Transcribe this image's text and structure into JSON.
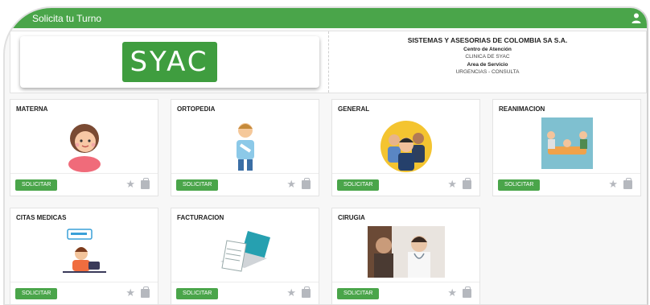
{
  "appbar": {
    "title": "Solicita tu Turno"
  },
  "header": {
    "logo_text": "SYAC",
    "company": "SISTEMAS Y ASESORIAS DE COLOMBIA SA S.A.",
    "centro_label": "Centro de Atención",
    "centro_value": "CLINICA DE SYAC",
    "area_label": "Area de Servicio",
    "area_value": "URGENCIAS - CONSULTA"
  },
  "cards": [
    {
      "title": "MATERNA",
      "button": "SOLICITAR"
    },
    {
      "title": "ORTOPEDIA",
      "button": "SOLICITAR"
    },
    {
      "title": "GENERAL",
      "button": "SOLICITAR"
    },
    {
      "title": "REANIMACION",
      "button": "SOLICITAR"
    },
    {
      "title": "CITAS MEDICAS",
      "button": "SOLICITAR"
    },
    {
      "title": "FACTURACION",
      "button": "SOLICITAR"
    },
    {
      "title": "CIRUGIA",
      "button": "SOLICITAR"
    }
  ],
  "colors": {
    "primary": "#4aa54a",
    "icon_gray": "#b5b8be"
  },
  "icons": {
    "user": "user-icon",
    "favorite": "star-icon",
    "bag": "briefcase-icon"
  }
}
